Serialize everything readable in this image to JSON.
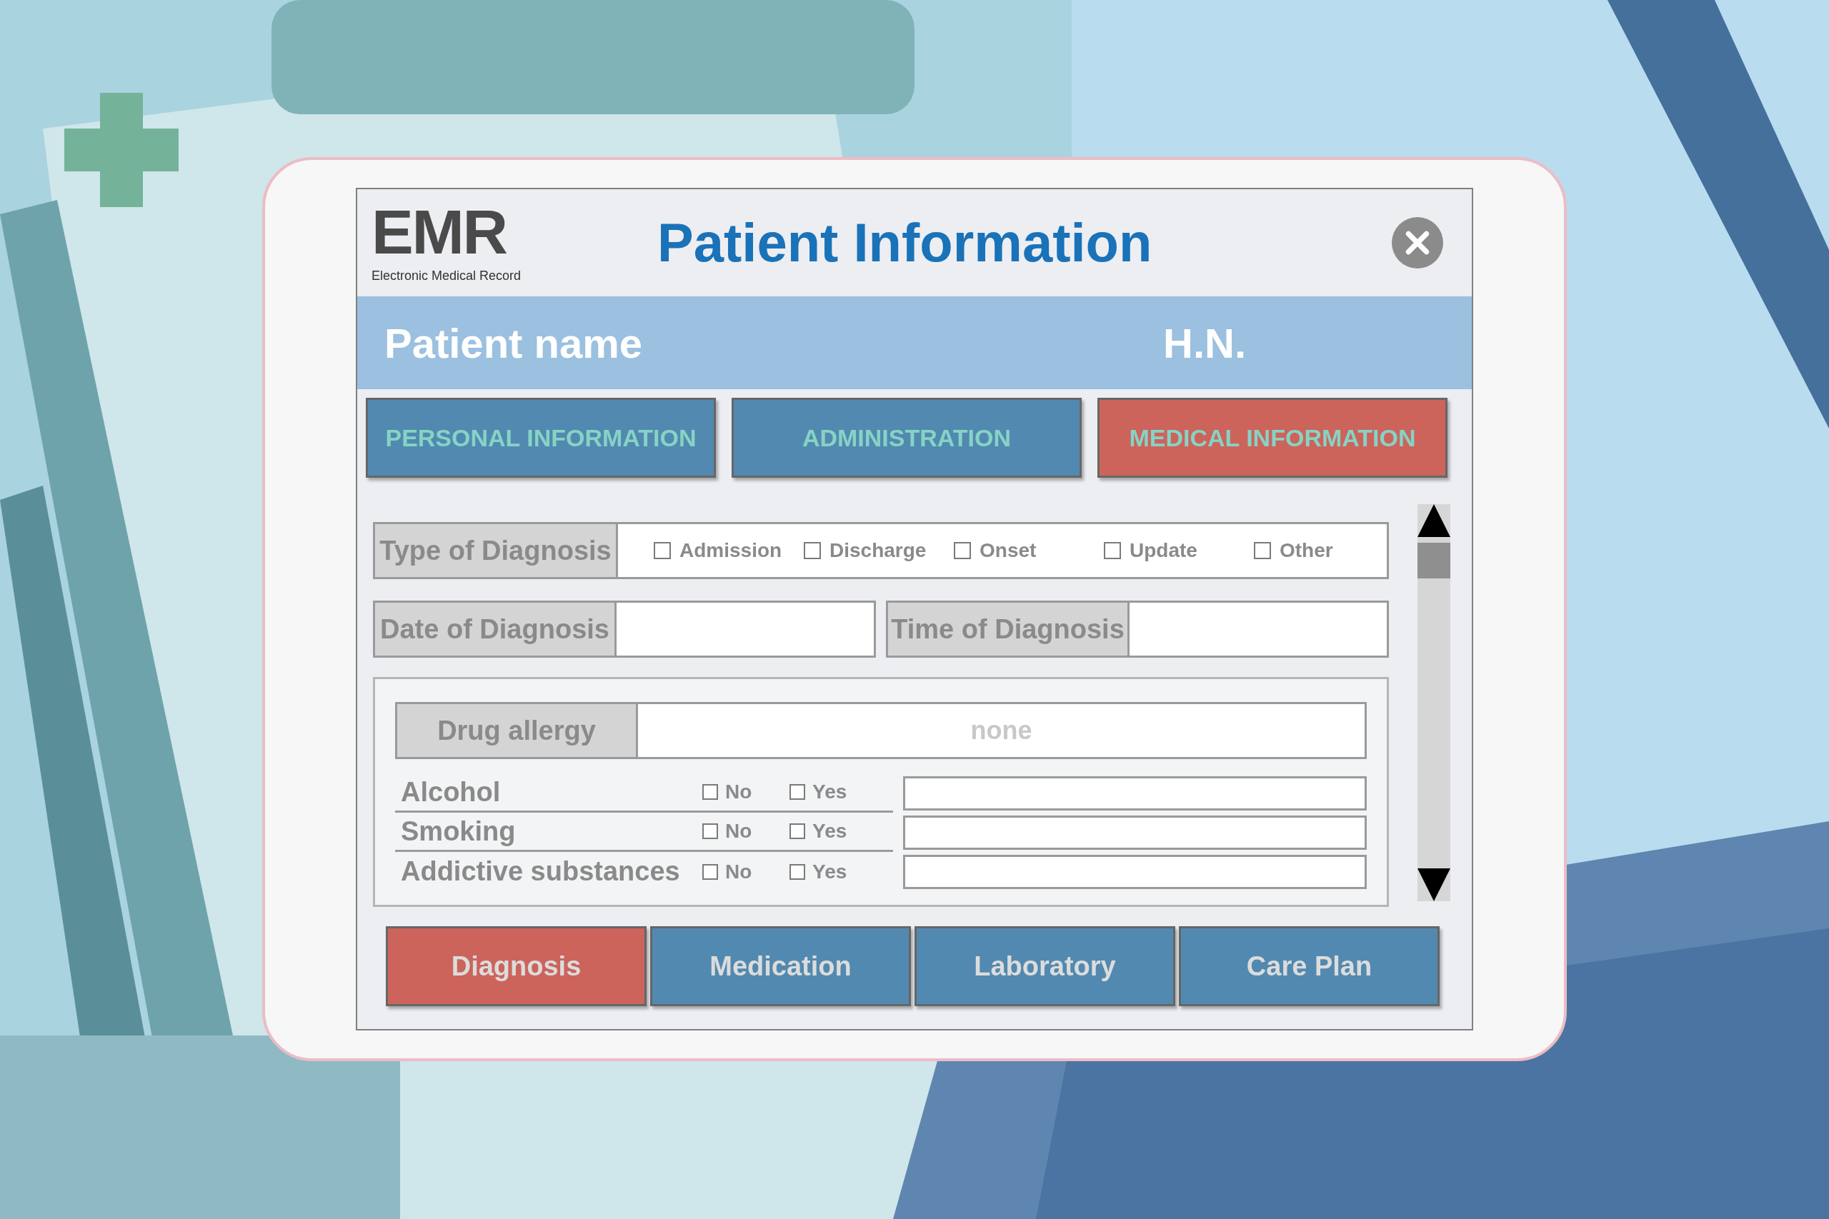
{
  "logo": {
    "title": "EMR",
    "subtitle": "Electronic Medical Record"
  },
  "title": "Patient Information",
  "patient_bar": {
    "name_label": "Patient name",
    "hn_label": "H.N."
  },
  "section_tabs": [
    {
      "label": "PERSONAL INFORMATION",
      "selected": false
    },
    {
      "label": "ADMINISTRATION",
      "selected": false
    },
    {
      "label": "MEDICAL INFORMATION",
      "selected": true
    }
  ],
  "diagnosis_type": {
    "label": "Type of Diagnosis",
    "options": [
      {
        "label": "Admission",
        "checked": false
      },
      {
        "label": "Discharge",
        "checked": false
      },
      {
        "label": "Onset",
        "checked": false
      },
      {
        "label": "Update",
        "checked": false
      },
      {
        "label": "Other",
        "checked": false
      }
    ]
  },
  "date_field": {
    "label": "Date of Diagnosis"
  },
  "time_field": {
    "label": "Time of Diagnosis"
  },
  "drug_allergy": {
    "label": "Drug allergy",
    "placeholder": "none"
  },
  "habits": [
    {
      "label": "Alcohol",
      "options": [
        {
          "label": "No",
          "checked": false
        },
        {
          "label": "Yes",
          "checked": false
        }
      ]
    },
    {
      "label": "Smoking",
      "options": [
        {
          "label": "No",
          "checked": false
        },
        {
          "label": "Yes",
          "checked": false
        }
      ]
    },
    {
      "label": "Addictive substances",
      "options": [
        {
          "label": "No",
          "checked": false
        },
        {
          "label": "Yes",
          "checked": false
        }
      ]
    }
  ],
  "bottom_tabs": [
    {
      "label": "Diagnosis",
      "selected": true
    },
    {
      "label": "Medication",
      "selected": false
    },
    {
      "label": "Laboratory",
      "selected": false
    },
    {
      "label": "Care Plan",
      "selected": false
    }
  ]
}
